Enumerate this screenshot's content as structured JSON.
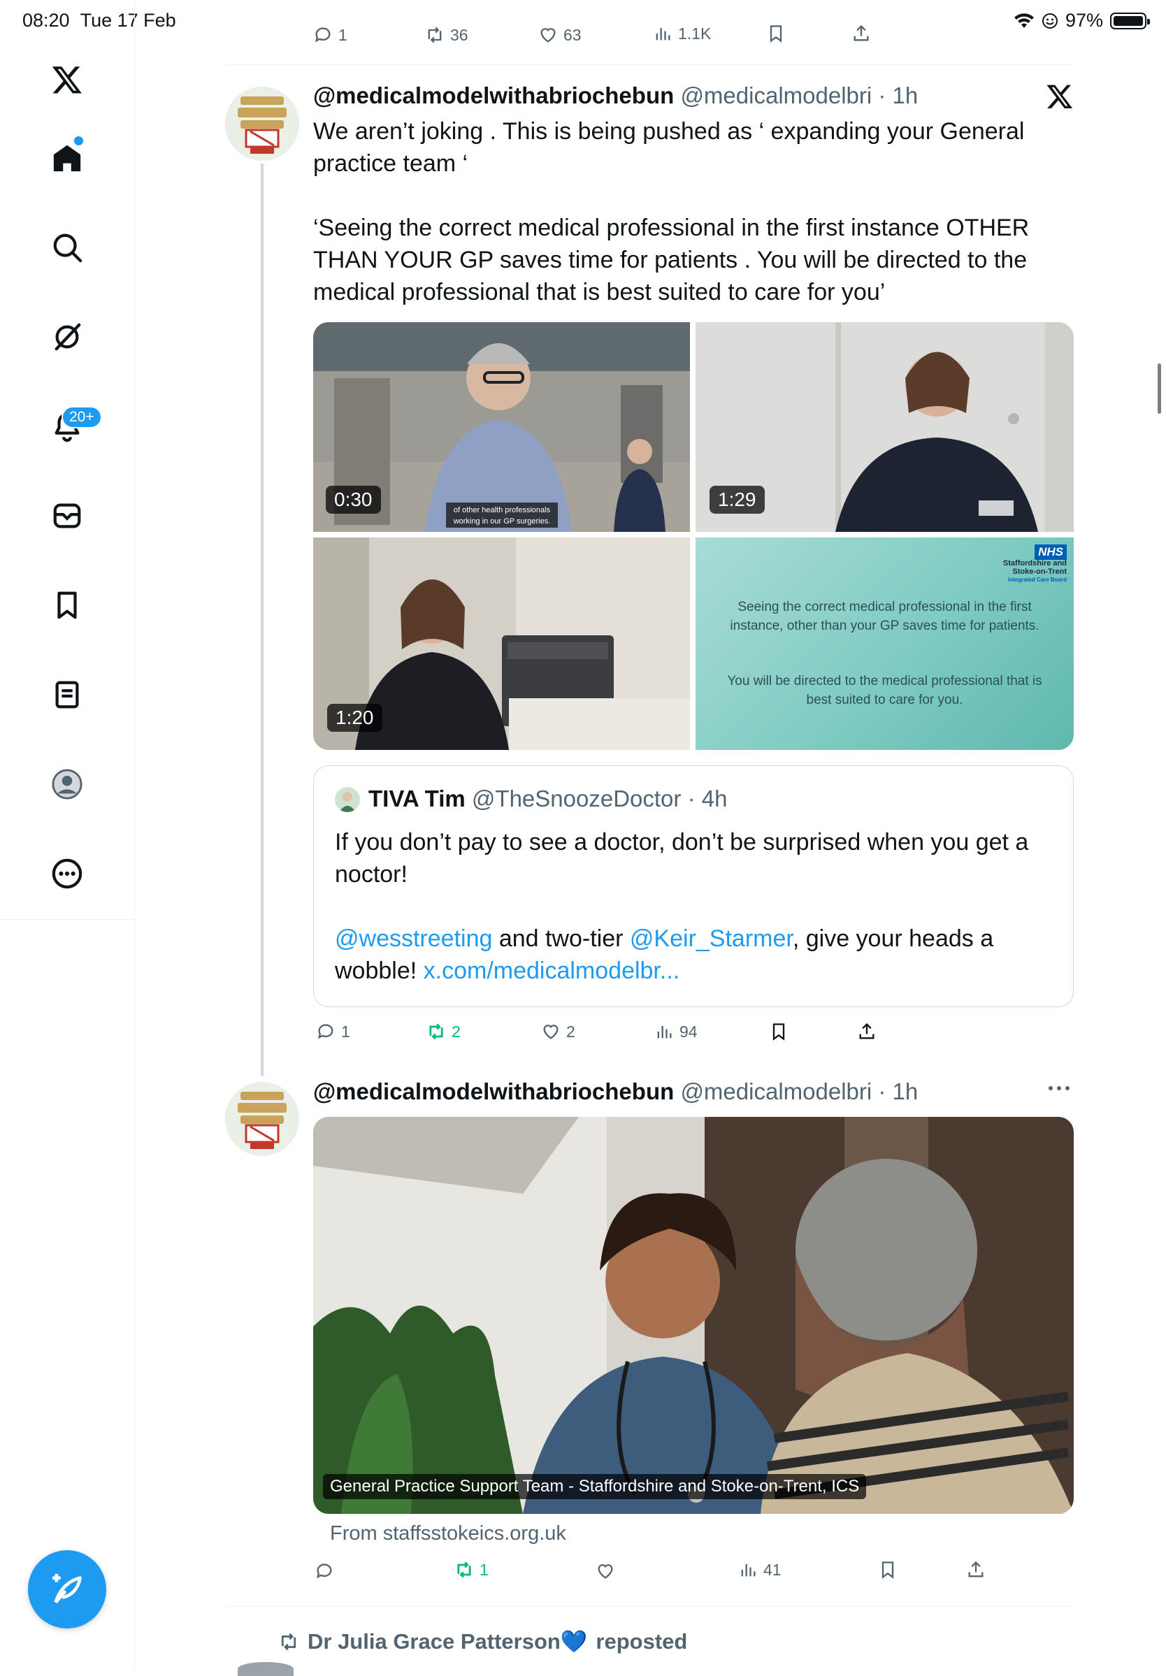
{
  "status_bar": {
    "time": "08:20",
    "date": "Tue 17 Feb",
    "battery": "97%"
  },
  "colors": {
    "accent": "#1d9bf0",
    "text": "#0f1419",
    "secondary": "#536471",
    "repost_green": "#00ba7c",
    "border": "#eff3f4"
  },
  "sidebar": {
    "items": [
      {
        "icon": "x-logo-icon"
      },
      {
        "icon": "home-icon"
      },
      {
        "icon": "search-icon"
      },
      {
        "icon": "grok-icon"
      },
      {
        "icon": "notifications-icon",
        "badge": "20+"
      },
      {
        "icon": "messages-icon"
      },
      {
        "icon": "bookmarks-icon"
      },
      {
        "icon": "lists-icon"
      },
      {
        "icon": "profile-icon"
      },
      {
        "icon": "more-icon"
      }
    ],
    "compose": "compose-icon"
  },
  "prev_tweet_actions": {
    "replies": "1",
    "reposts": "36",
    "likes": "63",
    "views": "1.1K"
  },
  "tweet1": {
    "name": "@medicalmodelwithabriochebun",
    "handle": "@medicalmodelbri",
    "time": "· 1h",
    "text_p1": "We aren’t joking . This is being pushed as ‘ expanding your General practice team ‘",
    "text_p2": "‘Seeing the correct medical professional in the first instance OTHER THAN YOUR GP saves time for patients . You will be directed to the medical professional that is best suited to care for you’",
    "media": [
      {
        "duration": "0:30",
        "subtitle_line1": "of other health professionals",
        "subtitle_line2": "working in our GP surgeries."
      },
      {
        "duration": "1:29"
      },
      {
        "duration": "1:20"
      },
      {
        "nhs_logo": "NHS",
        "org_line1": "Staffordshire and",
        "org_line2": "Stoke-on-Trent",
        "org_line3": "Integrated Care Board",
        "slide_text1": "Seeing the correct medical professional in the first instance, other than your GP saves time for patients.",
        "slide_text2": "You will be directed to the medical professional that is best suited to care for you."
      }
    ],
    "quote": {
      "name": "TIVA Tim",
      "handle": "@TheSnoozeDoctor",
      "time": "· 4h",
      "text_p1": "If you don’t pay to see a doctor, don’t be surprised when you get a noctor!",
      "mention1": "@wesstreeting",
      "text_mid": " and two-tier ",
      "mention2": "@Keir_Starmer",
      "text_after": ", give your heads a wobble! ",
      "link": "x.com/medicalmodelbr..."
    },
    "actions": {
      "replies": "1",
      "reposts": "2",
      "likes": "2",
      "views": "94"
    }
  },
  "tweet2": {
    "name": "@medicalmodelwithabriochebun",
    "handle": "@medicalmodelbri",
    "time": "· 1h",
    "card_caption": "General Practice Support Team - Staffordshire and Stoke-on-Trent, ICS",
    "card_source": "From staffsstokeics.org.uk",
    "actions": {
      "reposts": "1",
      "views": "41"
    }
  },
  "repost_banner": {
    "name": "Dr Julia Grace Patterson💙",
    "suffix": "reposted"
  }
}
